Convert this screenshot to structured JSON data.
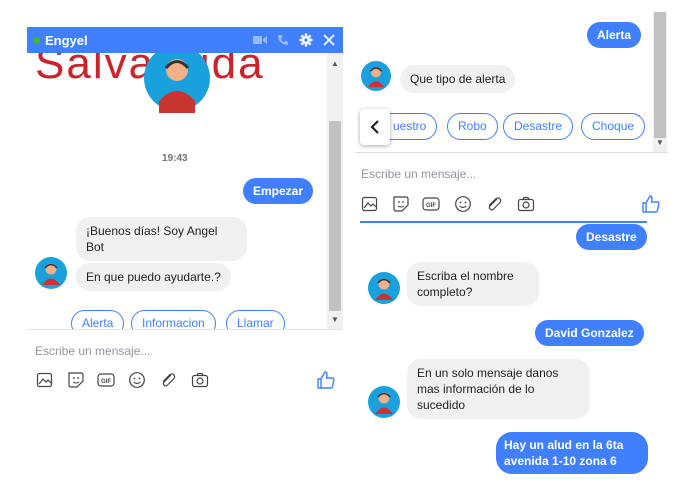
{
  "left": {
    "title": "Engyel",
    "banner": "Salva Vida",
    "timestamp": "19:43",
    "start_bubble": "Empezar",
    "greeting": "¡Buenos días! Soy Angel Bot",
    "question": "En que puedo ayudarte.?",
    "quick_replies": [
      "Alerta",
      "Informacion",
      "Llamar"
    ],
    "input_placeholder": "Escribe un mensaje..."
  },
  "right_top": {
    "user_msg": "Alerta",
    "bot_msg": "Que tipo de alerta",
    "quick_replies": [
      "uestro",
      "Robo",
      "Desastre",
      "Choque"
    ],
    "input_placeholder": "Escribe un mensaje..."
  },
  "right_bottom": {
    "msg1": "Desastre",
    "bot1": "Escriba el nombre completo?",
    "msg2": "David Gonzalez",
    "bot2": "En un solo mensaje danos mas información de lo sucedido",
    "msg3": "Hay un alud en la 6ta avenida 1-10 zona 6"
  },
  "colors": {
    "accent": "#4080ff",
    "brand_red": "#cc2229",
    "bubble_gray": "#f1f0f0",
    "online": "#42b72a"
  },
  "icons": [
    "video-icon",
    "phone-icon",
    "gear-icon",
    "close-icon",
    "image-icon",
    "sticker-icon",
    "gif-icon",
    "emoji-icon",
    "attach-icon",
    "camera-icon",
    "like-icon",
    "chevron-left-icon"
  ]
}
